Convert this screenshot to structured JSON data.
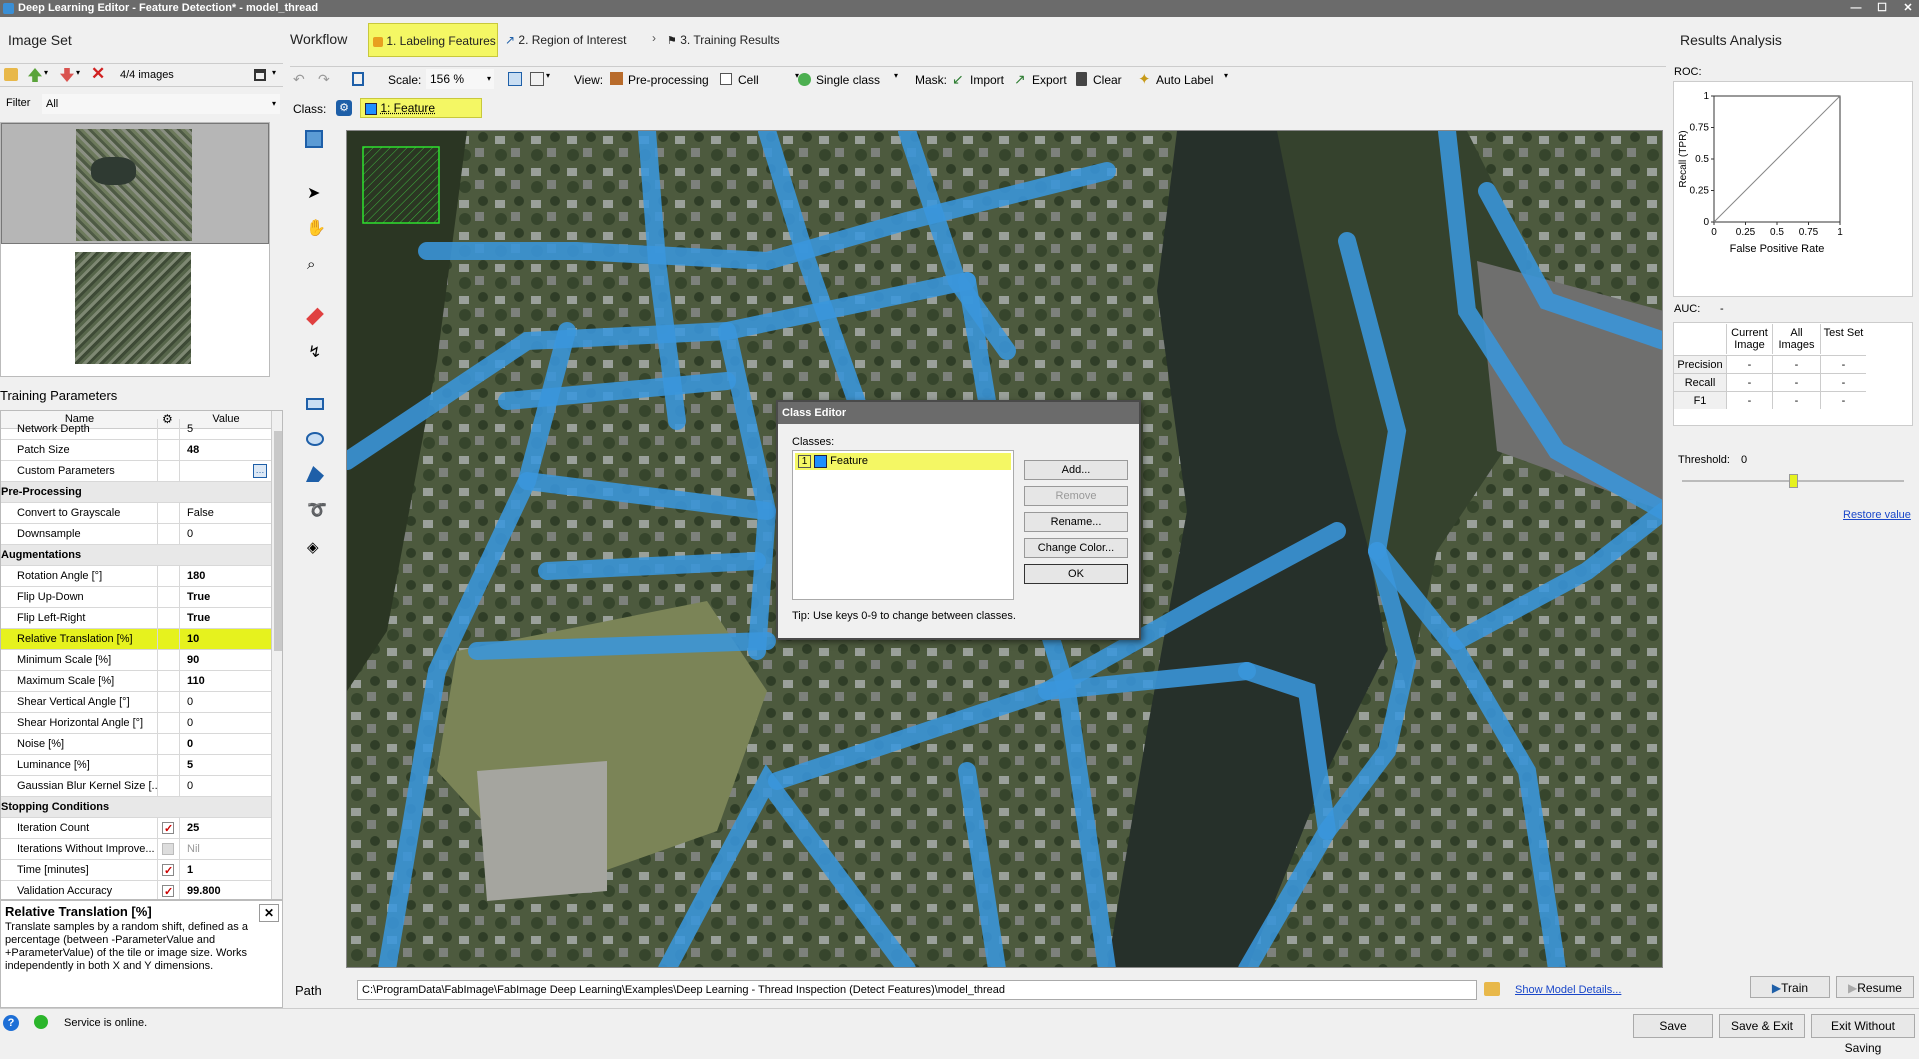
{
  "window": {
    "title": "Deep Learning Editor - Feature Detection* - model_thread"
  },
  "image_set": {
    "title": "Image Set",
    "count": "4/4 images",
    "filter_label": "Filter",
    "filter_value": "All"
  },
  "workflow": {
    "title": "Workflow",
    "steps": [
      "1. Labeling Features",
      "2. Region of Interest",
      "3. Training Results"
    ]
  },
  "toolbar": {
    "scale_label": "Scale:",
    "scale_value": "156 %",
    "view_label": "View:",
    "preprocessing": "Pre-processing",
    "cell": "Cell",
    "single_class": "Single class",
    "mask_label": "Mask:",
    "import": "Import",
    "export": "Export",
    "clear": "Clear",
    "auto_label": "Auto Label"
  },
  "class_bar": {
    "label": "Class:",
    "current": "1: Feature",
    "color": "#1e90ff"
  },
  "training": {
    "title": "Training Parameters",
    "col_name": "Name",
    "col_value": "Value",
    "rows": [
      {
        "name": "Network Depth",
        "value": "5",
        "type": "cut"
      },
      {
        "name": "Patch Size",
        "value": "48",
        "type": "bold"
      },
      {
        "name": "Custom Parameters",
        "value": "",
        "type": "ellipsis"
      },
      {
        "name": "Pre-Processing",
        "type": "cat"
      },
      {
        "name": "Convert to Grayscale",
        "value": "False"
      },
      {
        "name": "Downsample",
        "value": "0"
      },
      {
        "name": "Augmentations",
        "type": "cat"
      },
      {
        "name": "Rotation Angle [°]",
        "value": "180",
        "type": "bold"
      },
      {
        "name": "Flip Up-Down",
        "value": "True",
        "type": "bold"
      },
      {
        "name": "Flip Left-Right",
        "value": "True",
        "type": "bold"
      },
      {
        "name": "Relative Translation [%]",
        "value": "10",
        "type": "selected"
      },
      {
        "name": "Minimum Scale [%]",
        "value": "90",
        "type": "bold"
      },
      {
        "name": "Maximum Scale [%]",
        "value": "110",
        "type": "bold"
      },
      {
        "name": "Shear Vertical Angle [°]",
        "value": "0"
      },
      {
        "name": "Shear Horizontal Angle [°]",
        "value": "0"
      },
      {
        "name": "Noise [%]",
        "value": "0",
        "type": "bold"
      },
      {
        "name": "Luminance [%]",
        "value": "5",
        "type": "bold"
      },
      {
        "name": "Gaussian Blur Kernel Size [...",
        "value": "0"
      },
      {
        "name": "Stopping Conditions",
        "type": "cat"
      },
      {
        "name": "Iteration Count",
        "value": "25",
        "type": "bold",
        "check": "on"
      },
      {
        "name": "Iterations Without Improve...",
        "value": "Nil",
        "check": "dis"
      },
      {
        "name": "Time [minutes]",
        "value": "1",
        "type": "bold",
        "check": "on"
      },
      {
        "name": "Validation Accuracy",
        "value": "99.800",
        "type": "bold",
        "check": "on"
      }
    ],
    "description_title": "Relative Translation [%]",
    "description": "Translate samples by a random shift, defined as a percentage (between -ParameterValue and +ParameterValue) of the tile or image size. Works independently in both X and Y dimensions."
  },
  "class_editor": {
    "title": "Class Editor",
    "classes_label": "Classes:",
    "classes": [
      {
        "index": "1",
        "name": "Feature"
      }
    ],
    "buttons": [
      "Add...",
      "Remove",
      "Rename...",
      "Change Color...",
      "OK"
    ],
    "tip": "Tip: Use keys 0-9 to change between classes."
  },
  "results": {
    "title": "Results Analysis",
    "roc_label": "ROC:",
    "auc_label": "AUC:",
    "auc_value": "-",
    "columns": [
      "Current Image",
      "All Images",
      "Test Set"
    ],
    "rows": [
      {
        "name": "Precision",
        "values": [
          "-",
          "-",
          "-"
        ]
      },
      {
        "name": "Recall",
        "values": [
          "-",
          "-",
          "-"
        ]
      },
      {
        "name": "F1",
        "values": [
          "-",
          "-",
          "-"
        ]
      }
    ],
    "threshold_label": "Threshold:",
    "threshold_value": "0",
    "restore": "Restore value"
  },
  "chart_data": {
    "type": "line",
    "xlabel": "False Positive Rate",
    "ylabel": "Recall (TPR)",
    "x_ticks": [
      "0",
      "0.25",
      "0.5",
      "0.75",
      "1"
    ],
    "y_ticks": [
      "0",
      "0.25",
      "0.5",
      "0.75",
      "1"
    ],
    "xlim": [
      0,
      1
    ],
    "ylim": [
      0,
      1
    ],
    "series": [
      {
        "x": [
          0,
          1
        ],
        "y": [
          0,
          1
        ]
      }
    ]
  },
  "path": {
    "label": "Path",
    "value": "C:\\ProgramData\\FabImage\\FabImage Deep Learning\\Examples\\Deep Learning - Thread Inspection (Detect Features)\\model_thread",
    "show_details": "Show Model Details..."
  },
  "actions": {
    "train": "Train",
    "resume": "Resume",
    "save": "Save",
    "save_exit": "Save & Exit",
    "exit_no_save": "Exit Without Saving"
  },
  "status": {
    "text": "Service is online."
  },
  "colors": {
    "label_blue": "#3a96dc",
    "highlight": "#e6f21e",
    "accent": "#1e5fa8"
  }
}
